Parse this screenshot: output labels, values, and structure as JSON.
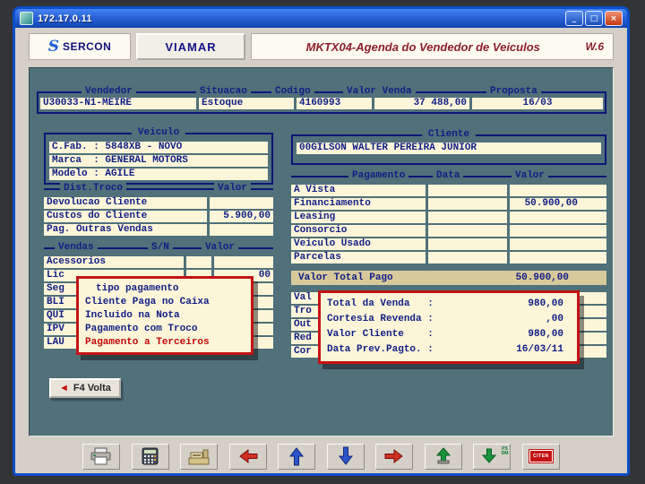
{
  "window": {
    "title": "172.17.0.11",
    "controls": {
      "minimize": "_",
      "maximize": "□",
      "close": "×"
    }
  },
  "header": {
    "logo_glyph": "S",
    "logo_text": "SERCON",
    "tab": "VIAMAR",
    "title": "MKTX04-Agenda do Vendedor de Veiculos",
    "version": "W.6"
  },
  "top_fields": {
    "fields": [
      {
        "label": "Vendedor",
        "value": "U30033-N1-MEIRE"
      },
      {
        "label": "Situacao",
        "value": "Estoque"
      },
      {
        "label": "Codigo",
        "value": "4160993"
      },
      {
        "label": "Valor Venda",
        "value": "37 488,00"
      },
      {
        "label": "Proposta",
        "value": "16/03"
      }
    ]
  },
  "veiculo": {
    "title": "Veiculo",
    "rows": [
      {
        "label": "C.Fab. :",
        "value": "5848XB - NOVO"
      },
      {
        "label": "Marca  :",
        "value": "GENERAL MOTORS"
      },
      {
        "label": "Modelo :",
        "value": "AGILE"
      }
    ]
  },
  "dist_troco": {
    "title": "Dist.Troco",
    "valor_col": "Valor",
    "rows": [
      {
        "label": "Devolucao Cliente",
        "value": ""
      },
      {
        "label": "Custos do Cliente",
        "value": "5.900,00"
      },
      {
        "label": "Pag. Outras Vendas",
        "value": ""
      }
    ]
  },
  "vendas": {
    "title": "Vendas",
    "sn_col": "S/N",
    "valor_col": "Valor",
    "rows": [
      {
        "label": "Acessorios",
        "value": ""
      },
      {
        "label": "Lic",
        "value": "00"
      },
      {
        "label": "Seg",
        "value": ""
      },
      {
        "label": "BLI",
        "value": ""
      },
      {
        "label": "QUI",
        "value": ""
      },
      {
        "label": "IPV",
        "value": ""
      },
      {
        "label": "LAU",
        "value": ""
      }
    ]
  },
  "cliente": {
    "title": "Cliente",
    "value": "00GILSON WALTER PEREIRA JUNIOR"
  },
  "pagamento": {
    "title": "Pagamento",
    "data_col": "Data",
    "valor_col": "Valor",
    "rows": [
      {
        "label": "A Vista",
        "data": "",
        "valor": ""
      },
      {
        "label": "Financiamento",
        "data": "",
        "valor": "50.900,00"
      },
      {
        "label": "Leasing",
        "data": "",
        "valor": ""
      },
      {
        "label": "Consorcio",
        "data": "",
        "valor": ""
      },
      {
        "label": "Veiculo Usado",
        "data": "",
        "valor": ""
      },
      {
        "label": "Parcelas",
        "data": "",
        "valor": ""
      }
    ]
  },
  "total_pago": {
    "label": "Valor Total Pago",
    "value": "50.900,00"
  },
  "resumo_fragments": {
    "rows": [
      {
        "label": "Val"
      },
      {
        "label": "Tro"
      },
      {
        "label": "Out"
      },
      {
        "label": "Red"
      },
      {
        "label": "Cor"
      }
    ]
  },
  "popup_tipo_pagamento": {
    "title": "tipo pagamento",
    "items": [
      {
        "label": "Cliente Paga no Caixa"
      },
      {
        "label": "Incluido na Nota"
      },
      {
        "label": "Pagamento com Troco"
      },
      {
        "label": "Pagamento a Terceiros"
      }
    ]
  },
  "popup_resumo": {
    "rows": [
      {
        "label": "Total da Venda   :",
        "value": "980,00"
      },
      {
        "label": "Cortesia Revenda :",
        "value": ",00"
      },
      {
        "label": "Valor Cliente    :",
        "value": "980,00"
      },
      {
        "label": "Data Prev.Pagto. :",
        "value": "16/03/11"
      }
    ]
  },
  "f4_button": {
    "icon": "◄",
    "label": "F4 Volta"
  },
  "toolbar": {
    "icons": [
      {
        "name": "printer"
      },
      {
        "name": "calculator"
      },
      {
        "name": "cash-register"
      },
      {
        "name": "arrow-left-red"
      },
      {
        "name": "arrow-up-blue"
      },
      {
        "name": "arrow-down-blue"
      },
      {
        "name": "arrow-right-red"
      },
      {
        "name": "arrow-up-green"
      },
      {
        "name": "arrow-down-green",
        "label_top": "PS",
        "label_bottom": "DM"
      },
      {
        "name": "exit",
        "label": "CITEN"
      }
    ]
  }
}
